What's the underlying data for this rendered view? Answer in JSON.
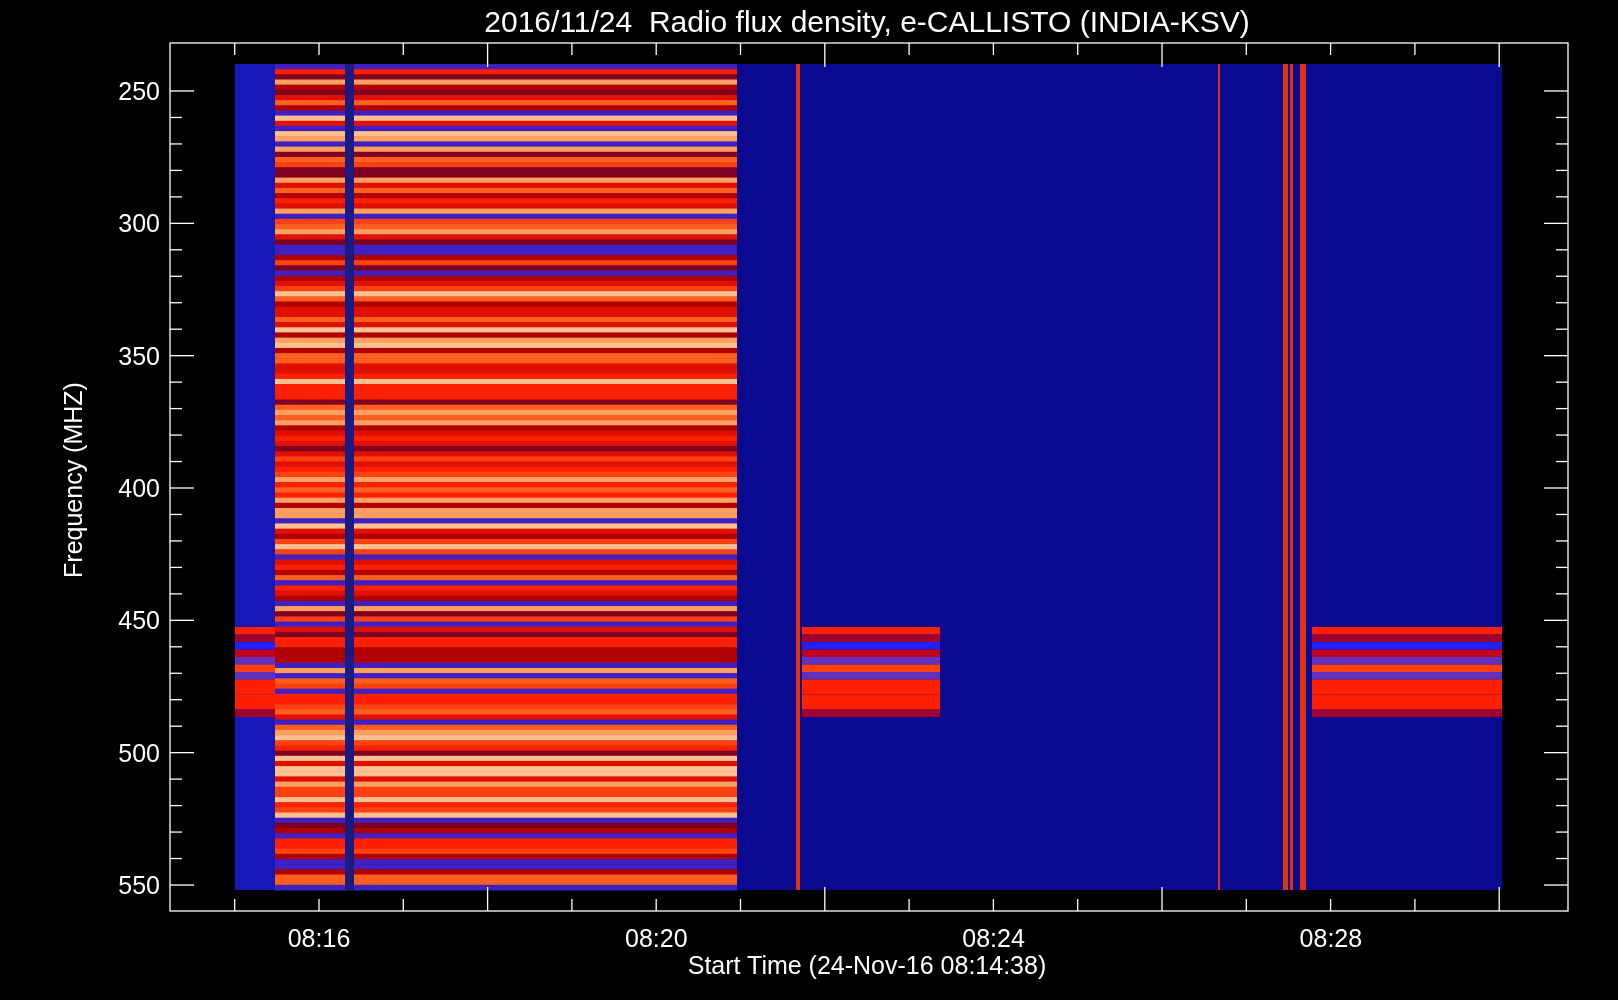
{
  "title": "2016/11/24  Radio flux density, e-CALLISTO (INDIA-KSV)",
  "x_axis": {
    "label": "Start Time (24-Nov-16 08:14:38)",
    "tick_labels": [
      "08:16",
      "08:20",
      "08:24",
      "08:28"
    ]
  },
  "y_axis": {
    "label": "Frequency (MHZ)",
    "tick_labels": [
      "250",
      "300",
      "350",
      "400",
      "450",
      "500",
      "550"
    ]
  }
}
